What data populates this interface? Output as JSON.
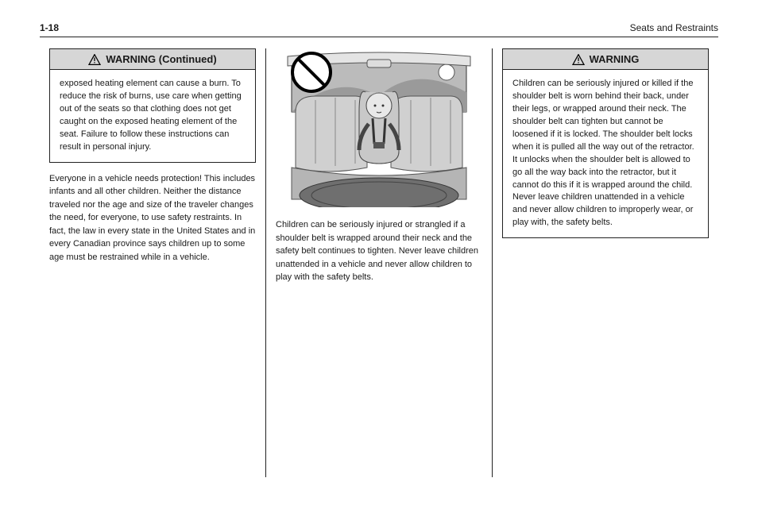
{
  "header": {
    "page_number": "1-18",
    "section": "Seats and Restraints"
  },
  "column1": {
    "warning_label": "WARNING (Continued)",
    "warning_body": "exposed heating element can cause a burn. To reduce the risk of burns, use care when getting out of the seats so that clothing does not get caught on the exposed heating element of the seat. Failure to follow these instructions can result in personal injury.",
    "after_text": "Everyone in a vehicle needs protection! This includes infants and all other children. Neither the distance traveled nor the age and size of the traveler changes the need, for everyone, to use safety restraints. In fact, the law in every state in the United States and in every Canadian province says children up to some age must be restrained while in a vehicle."
  },
  "column2": {
    "illustration_alt": "child-in-car-seat-illustration",
    "prohibition_icon": "no-symbol-icon",
    "body_text": "Children can be seriously injured or strangled if a shoulder belt is wrapped around their neck and the safety belt continues to tighten. Never leave children unattended in a vehicle and never allow children to play with the safety belts."
  },
  "column3": {
    "warning_label": "WARNING",
    "warning_body": "Children can be seriously injured or killed if the shoulder belt is worn behind their back, under their legs, or wrapped around their neck. The shoulder belt can tighten but cannot be loosened if it is locked. The shoulder belt locks when it is pulled all the way out of the retractor. It unlocks when the shoulder belt is allowed to go all the way back into the retractor, but it cannot do this if it is wrapped around the child. Never leave children unattended in a vehicle and never allow children to improperly wear, or play with, the safety belts."
  }
}
